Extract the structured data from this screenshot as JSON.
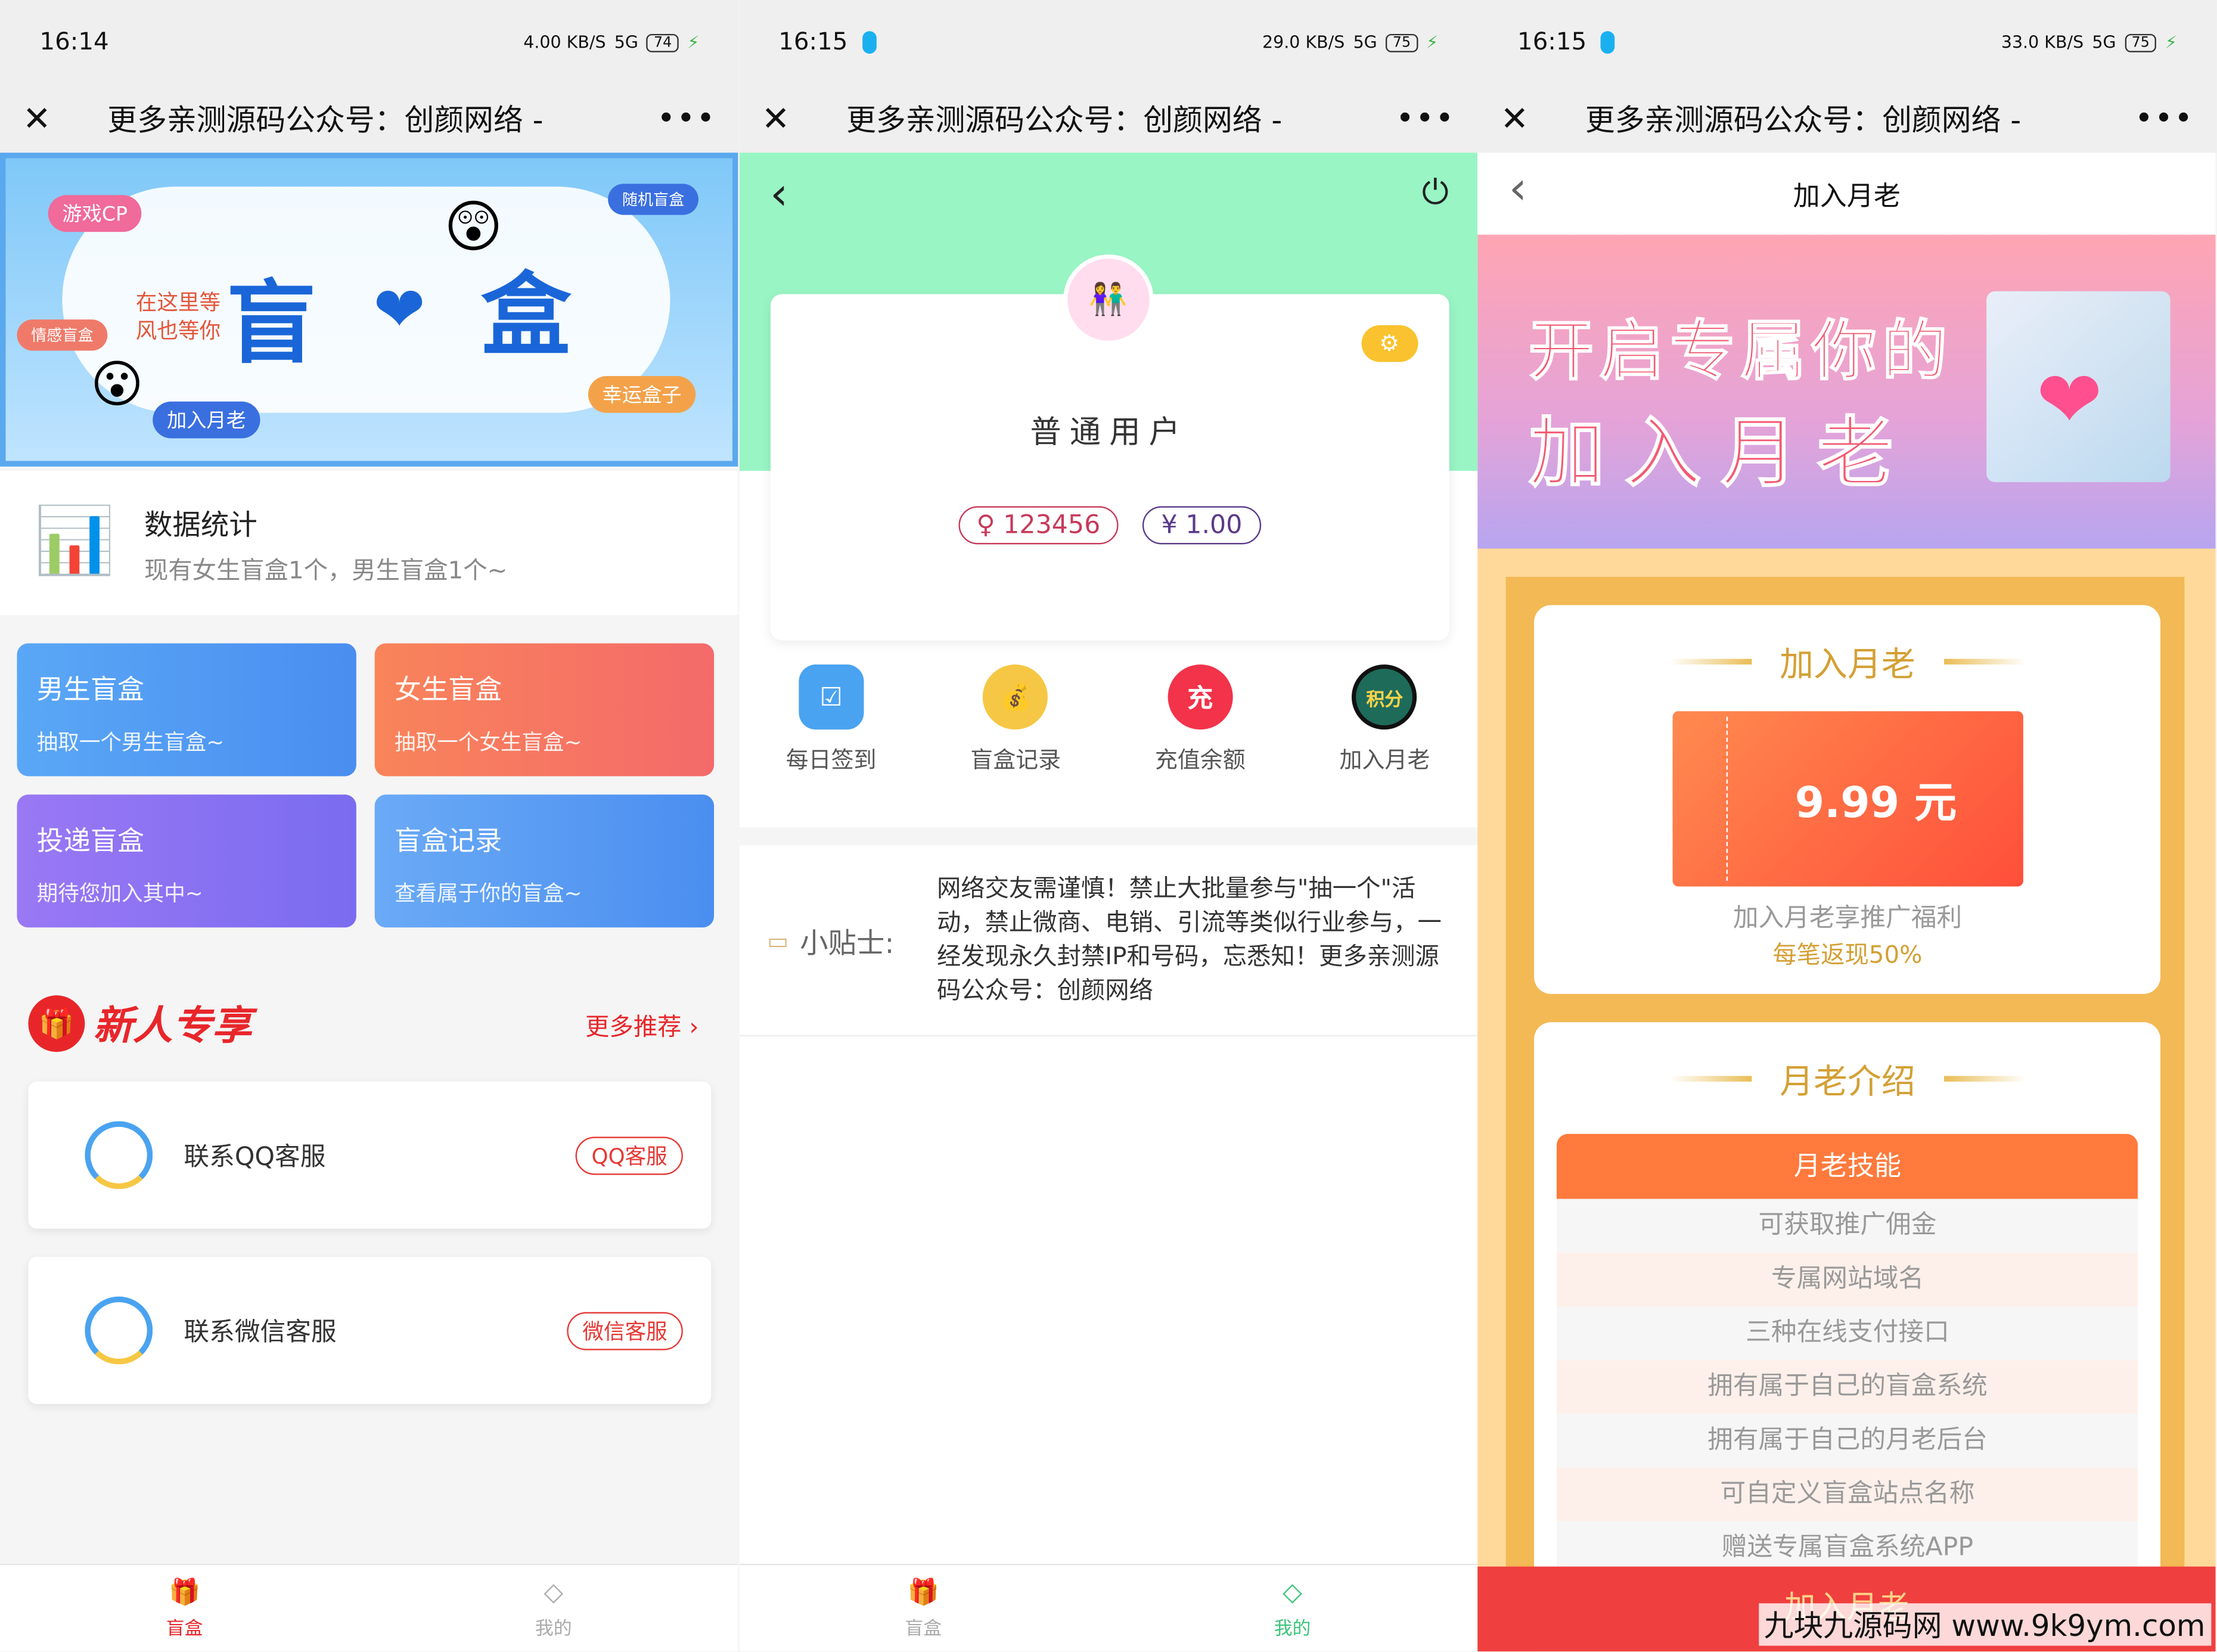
{
  "status_bars": [
    {
      "time": "16:14",
      "speed": "4.00 KB/S",
      "net": "5G",
      "battery": "74",
      "qq": false
    },
    {
      "time": "16:15",
      "speed": "29.0 KB/S",
      "net": "5G",
      "battery": "75",
      "qq": true
    },
    {
      "time": "16:15",
      "speed": "33.0 KB/S",
      "net": "5G",
      "battery": "75",
      "qq": true
    }
  ],
  "window_title": "更多亲测源码公众号：创颜网络 -",
  "home": {
    "banner": {
      "tags": [
        "游戏CP",
        "随机盲盒",
        "情感盲盒",
        "幸运盒子",
        "加入月老"
      ],
      "title_left": "盲",
      "title_right": "盒",
      "slogan": "在这里等风也等你"
    },
    "stats": {
      "title": "数据统计",
      "subtitle": "现有女生盲盒1个，男生盲盒1个~"
    },
    "grid": [
      {
        "title": "男生盲盒",
        "sub": "抽取一个男生盲盒~",
        "color": "#4a9cf5"
      },
      {
        "title": "女生盲盒",
        "sub": "抽取一个女生盲盒~",
        "color": "#f77a5c"
      },
      {
        "title": "投递盲盒",
        "sub": "期待您加入其中~",
        "color": "#8a6cf0"
      },
      {
        "title": "盲盒记录",
        "sub": "查看属于你的盲盒~",
        "color": "#4a9cf5"
      }
    ],
    "promo": {
      "title": "新人专享",
      "more": "更多推荐"
    },
    "contacts": [
      {
        "label": "联系QQ客服",
        "button": "QQ客服"
      },
      {
        "label": "联系微信客服",
        "button": "微信客服"
      }
    ]
  },
  "tabs": [
    {
      "label": "盲盒",
      "icon": "gift-icon"
    },
    {
      "label": "我的",
      "icon": "diamond-icon"
    }
  ],
  "profile": {
    "user_type": "普通用户",
    "id": "123456",
    "balance": "1.00",
    "gender_symbol": "♀",
    "currency_symbol": "¥",
    "menu": [
      {
        "label": "每日签到",
        "icon": "calendar-check-icon",
        "color": "#4aa3f0"
      },
      {
        "label": "盲盒记录",
        "icon": "gold-ingot-icon",
        "color": "#f6c744"
      },
      {
        "label": "充值余额",
        "icon": "money-bag-icon",
        "color": "#f2334a",
        "glyph": "充"
      },
      {
        "label": "加入月老",
        "icon": "points-badge-icon",
        "color": "#1e6b5a",
        "glyph": "积分"
      }
    ],
    "tips_label": "小贴士:",
    "tips_text": "网络交友需谨慎！禁止大批量参与\"抽一个\"活动，禁止微商、电销、引流等类似行业参与，一经发现永久封禁IP和号码，忘悉知！更多亲测源码公众号：创颜网络"
  },
  "join": {
    "page_title": "加入月老",
    "hero_line1": "开启专属你的",
    "hero_line2": "加入月老",
    "section1": "加入月老",
    "price": "9.99 元",
    "benefit": "加入月老享推广福利",
    "rebate": "每笔返现50%",
    "section2": "月老介绍",
    "skills_header": "月老技能",
    "skills": [
      "可获取推广佣金",
      "专属网站域名",
      "三种在线支付接口",
      "拥有属于自己的盲盒系统",
      "拥有属于自己的月老后台",
      "可自定义盲盒站点名称",
      "赠送专属盲盒系统APP"
    ],
    "cta": "加入月老"
  },
  "watermark": "九块九源码网 www.9k9ym.com"
}
